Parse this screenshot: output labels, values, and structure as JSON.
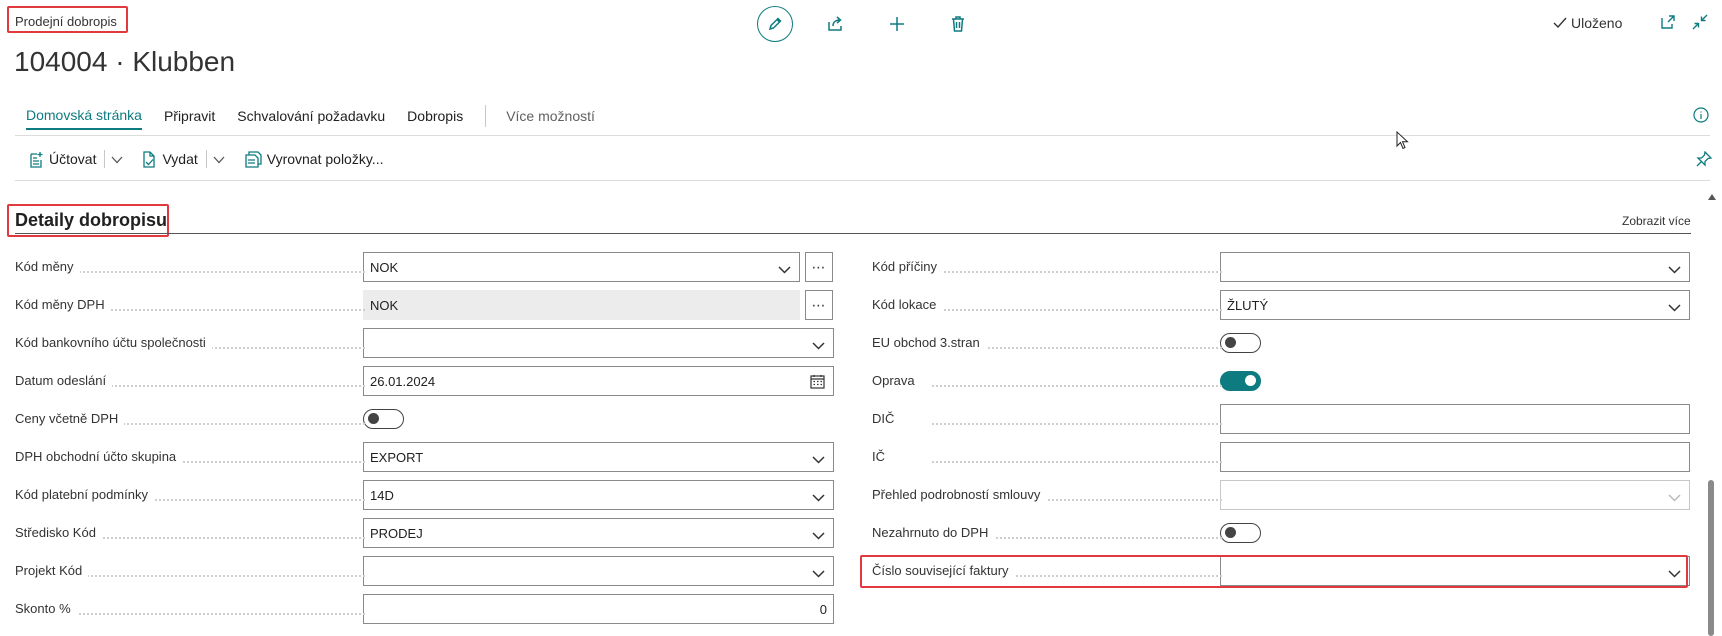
{
  "header": {
    "page_type": "Prodejní dobropis",
    "title": "104004 · Klubben",
    "saved_label": "Uloženo"
  },
  "tabs": [
    {
      "label": "Domovská stránka",
      "active": true
    },
    {
      "label": "Připravit"
    },
    {
      "label": "Schvalování požadavku"
    },
    {
      "label": "Dobropis"
    },
    {
      "label": "Více možností"
    }
  ],
  "actions": {
    "post": "Účtovat",
    "release": "Vydat",
    "apply_entries": "Vyrovnat položky..."
  },
  "section": {
    "title": "Detaily dobropisu",
    "show_more": "Zobrazit více"
  },
  "left_fields": [
    {
      "label": "Kód měny",
      "value": "NOK"
    },
    {
      "label": "Kód měny DPH",
      "value": "NOK"
    },
    {
      "label": "Kód bankovního účtu společnosti",
      "value": ""
    },
    {
      "label": "Datum odeslání",
      "value": "26.01.2024"
    },
    {
      "label": "Ceny včetně DPH",
      "value": false
    },
    {
      "label": "DPH obchodní účto skupina",
      "value": "EXPORT"
    },
    {
      "label": "Kód platební podmínky",
      "value": "14D"
    },
    {
      "label": "Středisko Kód",
      "value": "PRODEJ"
    },
    {
      "label": "Projekt Kód",
      "value": ""
    },
    {
      "label": "Skonto %",
      "value": "0"
    }
  ],
  "right_fields": [
    {
      "label": "Kód příčiny",
      "value": ""
    },
    {
      "label": "Kód lokace",
      "value": "ŽLUTÝ"
    },
    {
      "label": "EU obchod 3.stran",
      "value": false
    },
    {
      "label": "Oprava",
      "value": true
    },
    {
      "label": "DIČ",
      "value": ""
    },
    {
      "label": "IČ",
      "value": ""
    },
    {
      "label": "Přehled podrobností smlouvy",
      "value": ""
    },
    {
      "label": "Nezahrnuto do DPH",
      "value": false
    },
    {
      "label": "Číslo související faktury",
      "value": ""
    }
  ],
  "colors": {
    "accent": "#0e7b80",
    "highlight": "#e0393e"
  },
  "icons": [
    "edit-icon",
    "share-icon",
    "add-icon",
    "delete-icon",
    "checkmark-icon",
    "open-new-window-icon",
    "collapse-icon",
    "info-icon",
    "post-icon",
    "release-icon",
    "apply-entries-icon",
    "pin-icon",
    "chevron-down-icon",
    "calendar-icon"
  ]
}
